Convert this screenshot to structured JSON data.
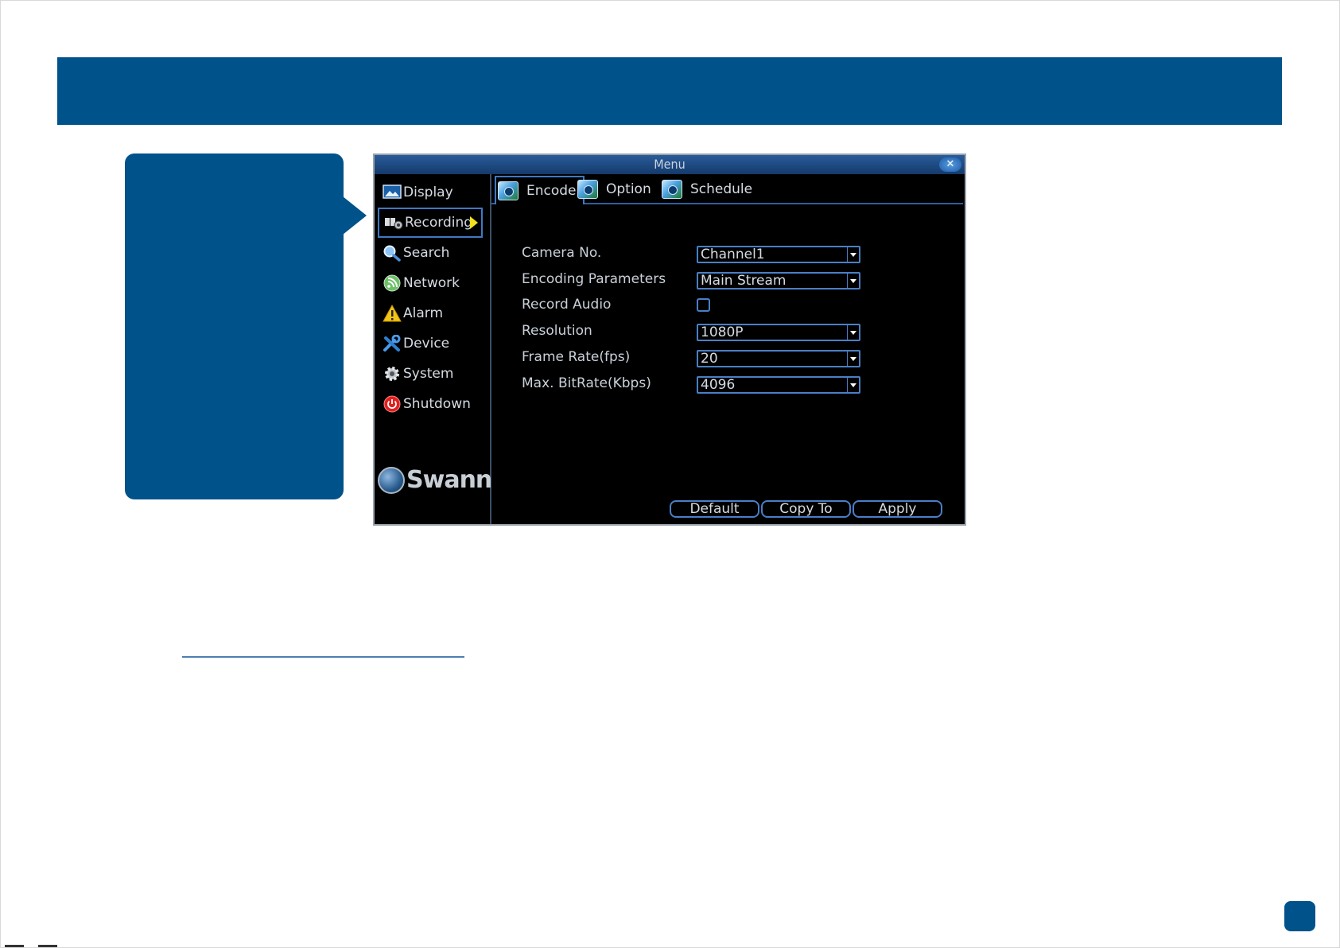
{
  "window": {
    "title": "Menu",
    "close_glyph": "✕"
  },
  "sidebar": {
    "items": [
      {
        "label": "Display",
        "icon": "display-icon"
      },
      {
        "label": "Recording",
        "icon": "recording-icon",
        "active": true
      },
      {
        "label": "Search",
        "icon": "search-icon"
      },
      {
        "label": "Network",
        "icon": "network-icon"
      },
      {
        "label": "Alarm",
        "icon": "alarm-icon"
      },
      {
        "label": "Device",
        "icon": "device-icon"
      },
      {
        "label": "System",
        "icon": "system-icon"
      },
      {
        "label": "Shutdown",
        "icon": "shutdown-icon"
      }
    ],
    "logo_text": "Swann"
  },
  "tabs": [
    {
      "label": "Encode",
      "active": true
    },
    {
      "label": "Option"
    },
    {
      "label": "Schedule"
    }
  ],
  "form": {
    "camera_no": {
      "label": "Camera No.",
      "value": "Channel1"
    },
    "encoding_parameters": {
      "label": "Encoding Parameters",
      "value": "Main Stream"
    },
    "record_audio": {
      "label": "Record Audio",
      "checked": false
    },
    "resolution": {
      "label": "Resolution",
      "value": "1080P"
    },
    "frame_rate": {
      "label": "Frame Rate(fps)",
      "value": "20"
    },
    "max_bitrate": {
      "label": "Max. BitRate(Kbps)",
      "value": "4096"
    }
  },
  "actions": {
    "default": "Default",
    "copy_to": "Copy To",
    "apply": "Apply"
  },
  "colors": {
    "brand_blue": "#00528b",
    "active_arrow": "#f3e21a",
    "control_border": "#4a7fc6"
  }
}
